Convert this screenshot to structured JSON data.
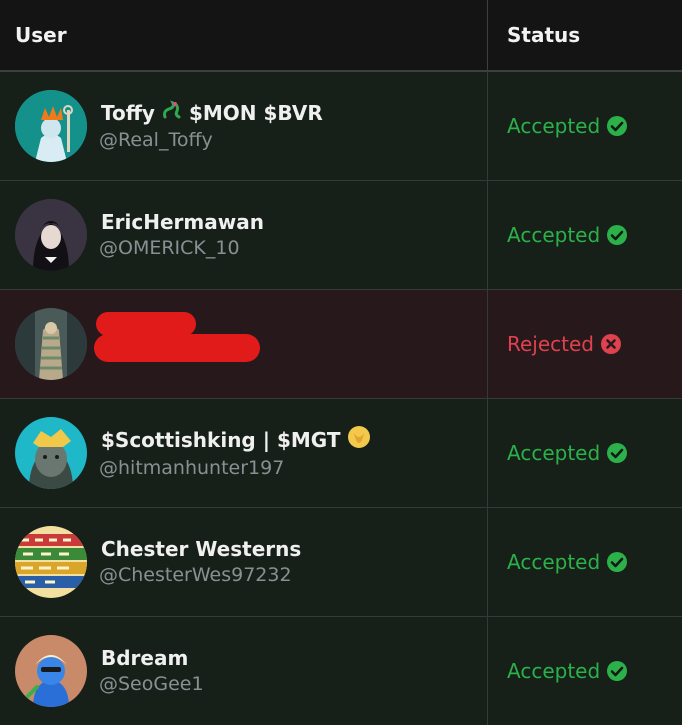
{
  "header": {
    "user_label": "User",
    "status_label": "Status"
  },
  "rows": [
    {
      "name": "Toffy",
      "name_suffix": "$MON $BVR",
      "handle": "@Real_Toffy",
      "status": "Accepted",
      "status_color": "#2bb04a"
    },
    {
      "name": "EricHermawan",
      "handle": "@OMERICK_10",
      "status": "Accepted",
      "status_color": "#2bb04a"
    },
    {
      "name": "",
      "handle": "",
      "status": "Rejected",
      "status_color": "#e0414f",
      "redacted": true
    },
    {
      "name": "$Scottishking | $MGT",
      "handle": "@hitmanhunter197",
      "status": "Accepted",
      "status_color": "#2bb04a"
    },
    {
      "name": "Chester Westerns",
      "handle": "@ChesterWes97232",
      "status": "Accepted",
      "status_color": "#2bb04a"
    },
    {
      "name": "Bdream",
      "handle": "@SeoGee1",
      "status": "Accepted",
      "status_color": "#2bb04a"
    }
  ],
  "icons": {
    "accepted": "check-circle-icon",
    "rejected": "x-circle-icon",
    "toffy_emoji": "dragon-icon",
    "scottish_emoji": "gold-badge-icon"
  }
}
